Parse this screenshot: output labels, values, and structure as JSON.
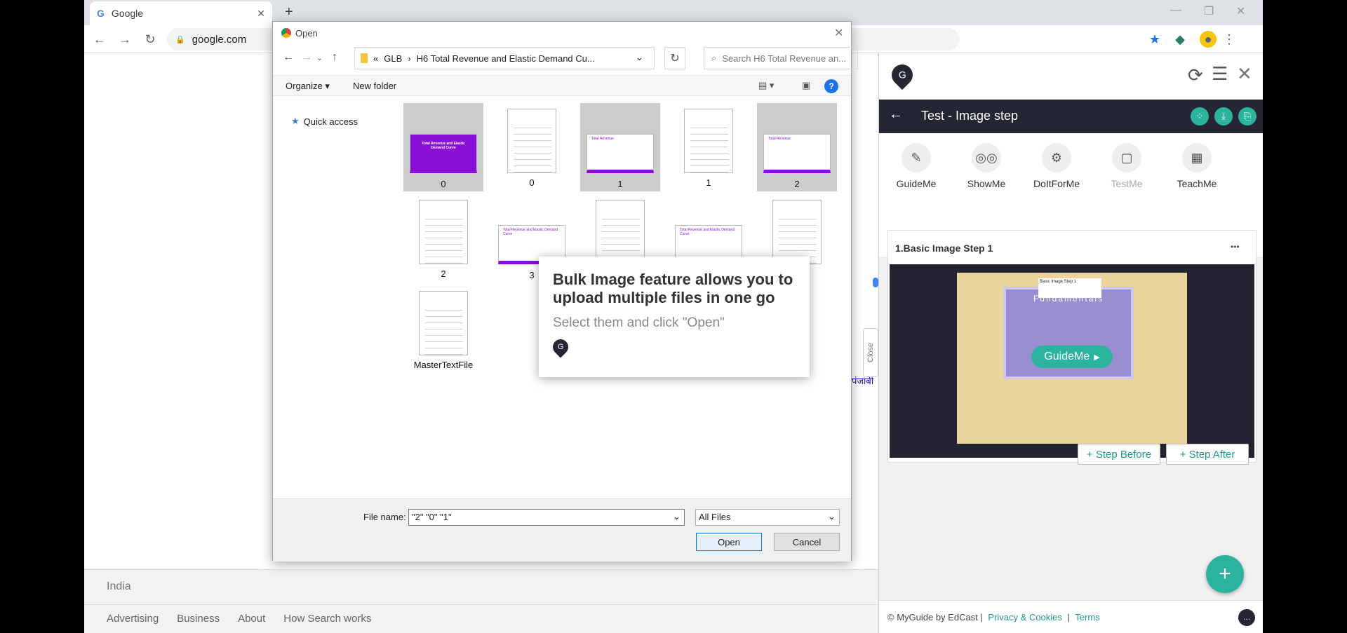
{
  "browser": {
    "tab_title": "Google",
    "url": "google.com",
    "new_tab": "+"
  },
  "google": {
    "country": "India",
    "links": [
      "Advertising",
      "Business",
      "About",
      "How Search works"
    ]
  },
  "dialog": {
    "title": "Open",
    "breadcrumb": [
      "GLB",
      "H6 Total Revenue and Elastic Demand Cu..."
    ],
    "search_placeholder": "Search H6 Total Revenue an...",
    "organize": "Organize ▾",
    "new_folder": "New folder",
    "quick_access": "Quick access",
    "files": [
      {
        "name": "0",
        "kind": "slide-purple",
        "selected": true,
        "thumb": "Total Revenue and Elastic Demand Curve"
      },
      {
        "name": "0",
        "kind": "doc",
        "selected": false
      },
      {
        "name": "1",
        "kind": "slide",
        "selected": true,
        "thumb": "Total Revenue"
      },
      {
        "name": "1",
        "kind": "doc",
        "selected": false
      },
      {
        "name": "2",
        "kind": "slide",
        "selected": true,
        "thumb": "Total Revenue"
      },
      {
        "name": "2",
        "kind": "doc",
        "selected": false
      },
      {
        "name": "3",
        "kind": "slide",
        "selected": false,
        "thumb": "Total Revenue and Elastic Demand Curve"
      },
      {
        "name": "",
        "kind": "doc",
        "selected": false
      },
      {
        "name": "",
        "kind": "slide",
        "selected": false,
        "thumb": "Total Revenue and Elastic Demand Curve"
      },
      {
        "name": "",
        "kind": "doc",
        "selected": false
      },
      {
        "name": "MasterTextFile",
        "kind": "doc",
        "selected": false
      }
    ],
    "file_name_label": "File name:",
    "file_name_value": "\"2\" \"0\" \"1\"",
    "file_type": "All Files",
    "open_label": "Open",
    "cancel_label": "Cancel"
  },
  "tooltip": {
    "title": "Bulk Image feature allows you to upload multiple files in one go",
    "subtitle": "Select them and click \"Open\""
  },
  "close_strip": "Close",
  "hindi_fragment": "पंजाबी",
  "panel": {
    "title": "Test - Image step",
    "modes": [
      "GuideMe",
      "ShowMe",
      "DoItForMe",
      "TestMe",
      "TeachMe"
    ],
    "step_title": "1.Basic Image Step 1",
    "step_menu": "•••",
    "preview_banner": "Fundamentals",
    "preview_card_title": "Basic Image Step 1",
    "guideme_pill": "GuideMe",
    "step_before": "+ Step Before",
    "step_after": "+ Step After",
    "add_button": "+",
    "footer_copyright": "© MyGuide by EdCast |",
    "footer_privacy": "Privacy & Cookies",
    "footer_sep": "|",
    "footer_terms": "Terms"
  },
  "colors": {
    "teal": "#2bb39d",
    "panel_bar": "#252633",
    "purple": "#8a0fd6"
  }
}
